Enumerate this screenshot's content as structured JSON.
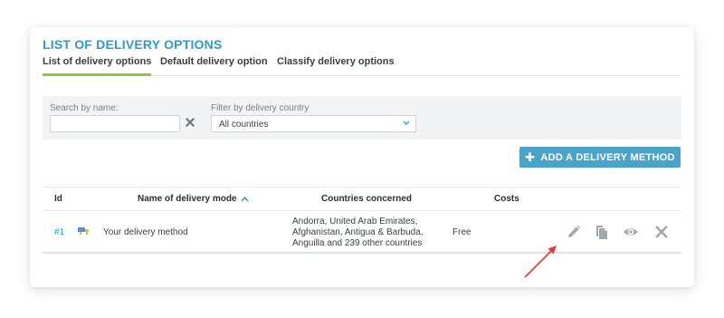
{
  "page": {
    "title": "LIST OF DELIVERY OPTIONS",
    "tabs": [
      {
        "label": "List of delivery options",
        "active": true
      },
      {
        "label": "Default delivery option",
        "active": false
      },
      {
        "label": "Classify delivery options",
        "active": false
      }
    ]
  },
  "filters": {
    "search_label": "Search by name:",
    "search_value": "",
    "search_placeholder": "",
    "clear_icon": "close-x-icon",
    "country_label": "Filter by delivery country",
    "country_selected": "All countries"
  },
  "actions": {
    "add_label": "ADD A DELIVERY METHOD",
    "add_icon": "plus-icon",
    "add_color": "#4aa4c9"
  },
  "table": {
    "columns": {
      "id": "Id",
      "name": "Name of delivery mode",
      "countries": "Countries concerned",
      "costs": "Costs"
    },
    "sort": {
      "column": "name",
      "direction": "asc"
    },
    "rows": [
      {
        "id": "#1",
        "icon": "delivery-truck-icon",
        "name": "Your delivery method",
        "countries": "Andorra, United Arab Emirates, Afghanistan, Antigua & Barbuda, Anguilla and 239 other countries",
        "cost": "Free",
        "row_actions": [
          "edit-pencil-icon",
          "duplicate-icon",
          "view-eye-icon",
          "delete-x-icon"
        ]
      }
    ]
  },
  "colors": {
    "accent": "#2a9bd5",
    "tab_underline": "#8dc63f",
    "annotation_arrow": "#e53935"
  }
}
